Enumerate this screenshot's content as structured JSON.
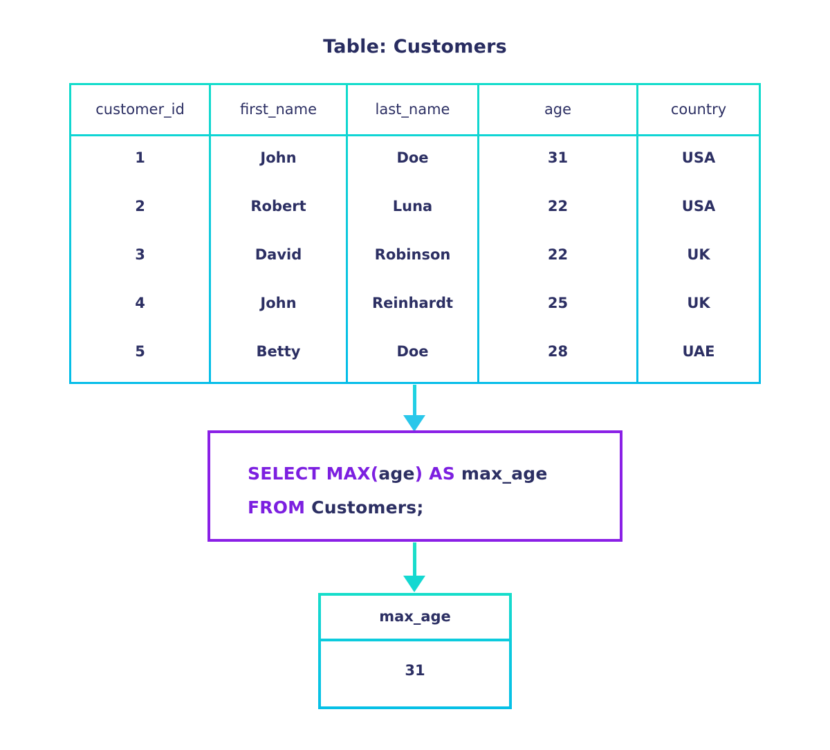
{
  "title": "Table: Customers",
  "source_table": {
    "columns": [
      "customer_id",
      "first_name",
      "last_name",
      "age",
      "country"
    ],
    "rows": [
      [
        "1",
        "John",
        "Doe",
        "31",
        "USA"
      ],
      [
        "2",
        "Robert",
        "Luna",
        "22",
        "USA"
      ],
      [
        "3",
        "David",
        "Robinson",
        "22",
        "UK"
      ],
      [
        "4",
        "John",
        "Reinhardt",
        "25",
        "UK"
      ],
      [
        "5",
        "Betty",
        "Doe",
        "28",
        "UAE"
      ]
    ]
  },
  "query": {
    "line1": {
      "kw1": "SELECT MAX(",
      "arg": "age",
      "kw2": ") AS ",
      "alias": "max_age"
    },
    "line2": {
      "kw": "FROM ",
      "table": "Customers;"
    },
    "full_text": "SELECT MAX(age) AS max_age FROM Customers;"
  },
  "result_table": {
    "column": "max_age",
    "value": "31"
  },
  "colors": {
    "table_border_top": "#10dccb",
    "table_border_bottom": "#02bde9",
    "text_navy": "#2c2f63",
    "keyword_purple": "#7c1fe0",
    "query_box_border": "#8a20e6",
    "arrow_cyan": "#2ac7ea",
    "arrow_teal": "#14d8d1"
  }
}
